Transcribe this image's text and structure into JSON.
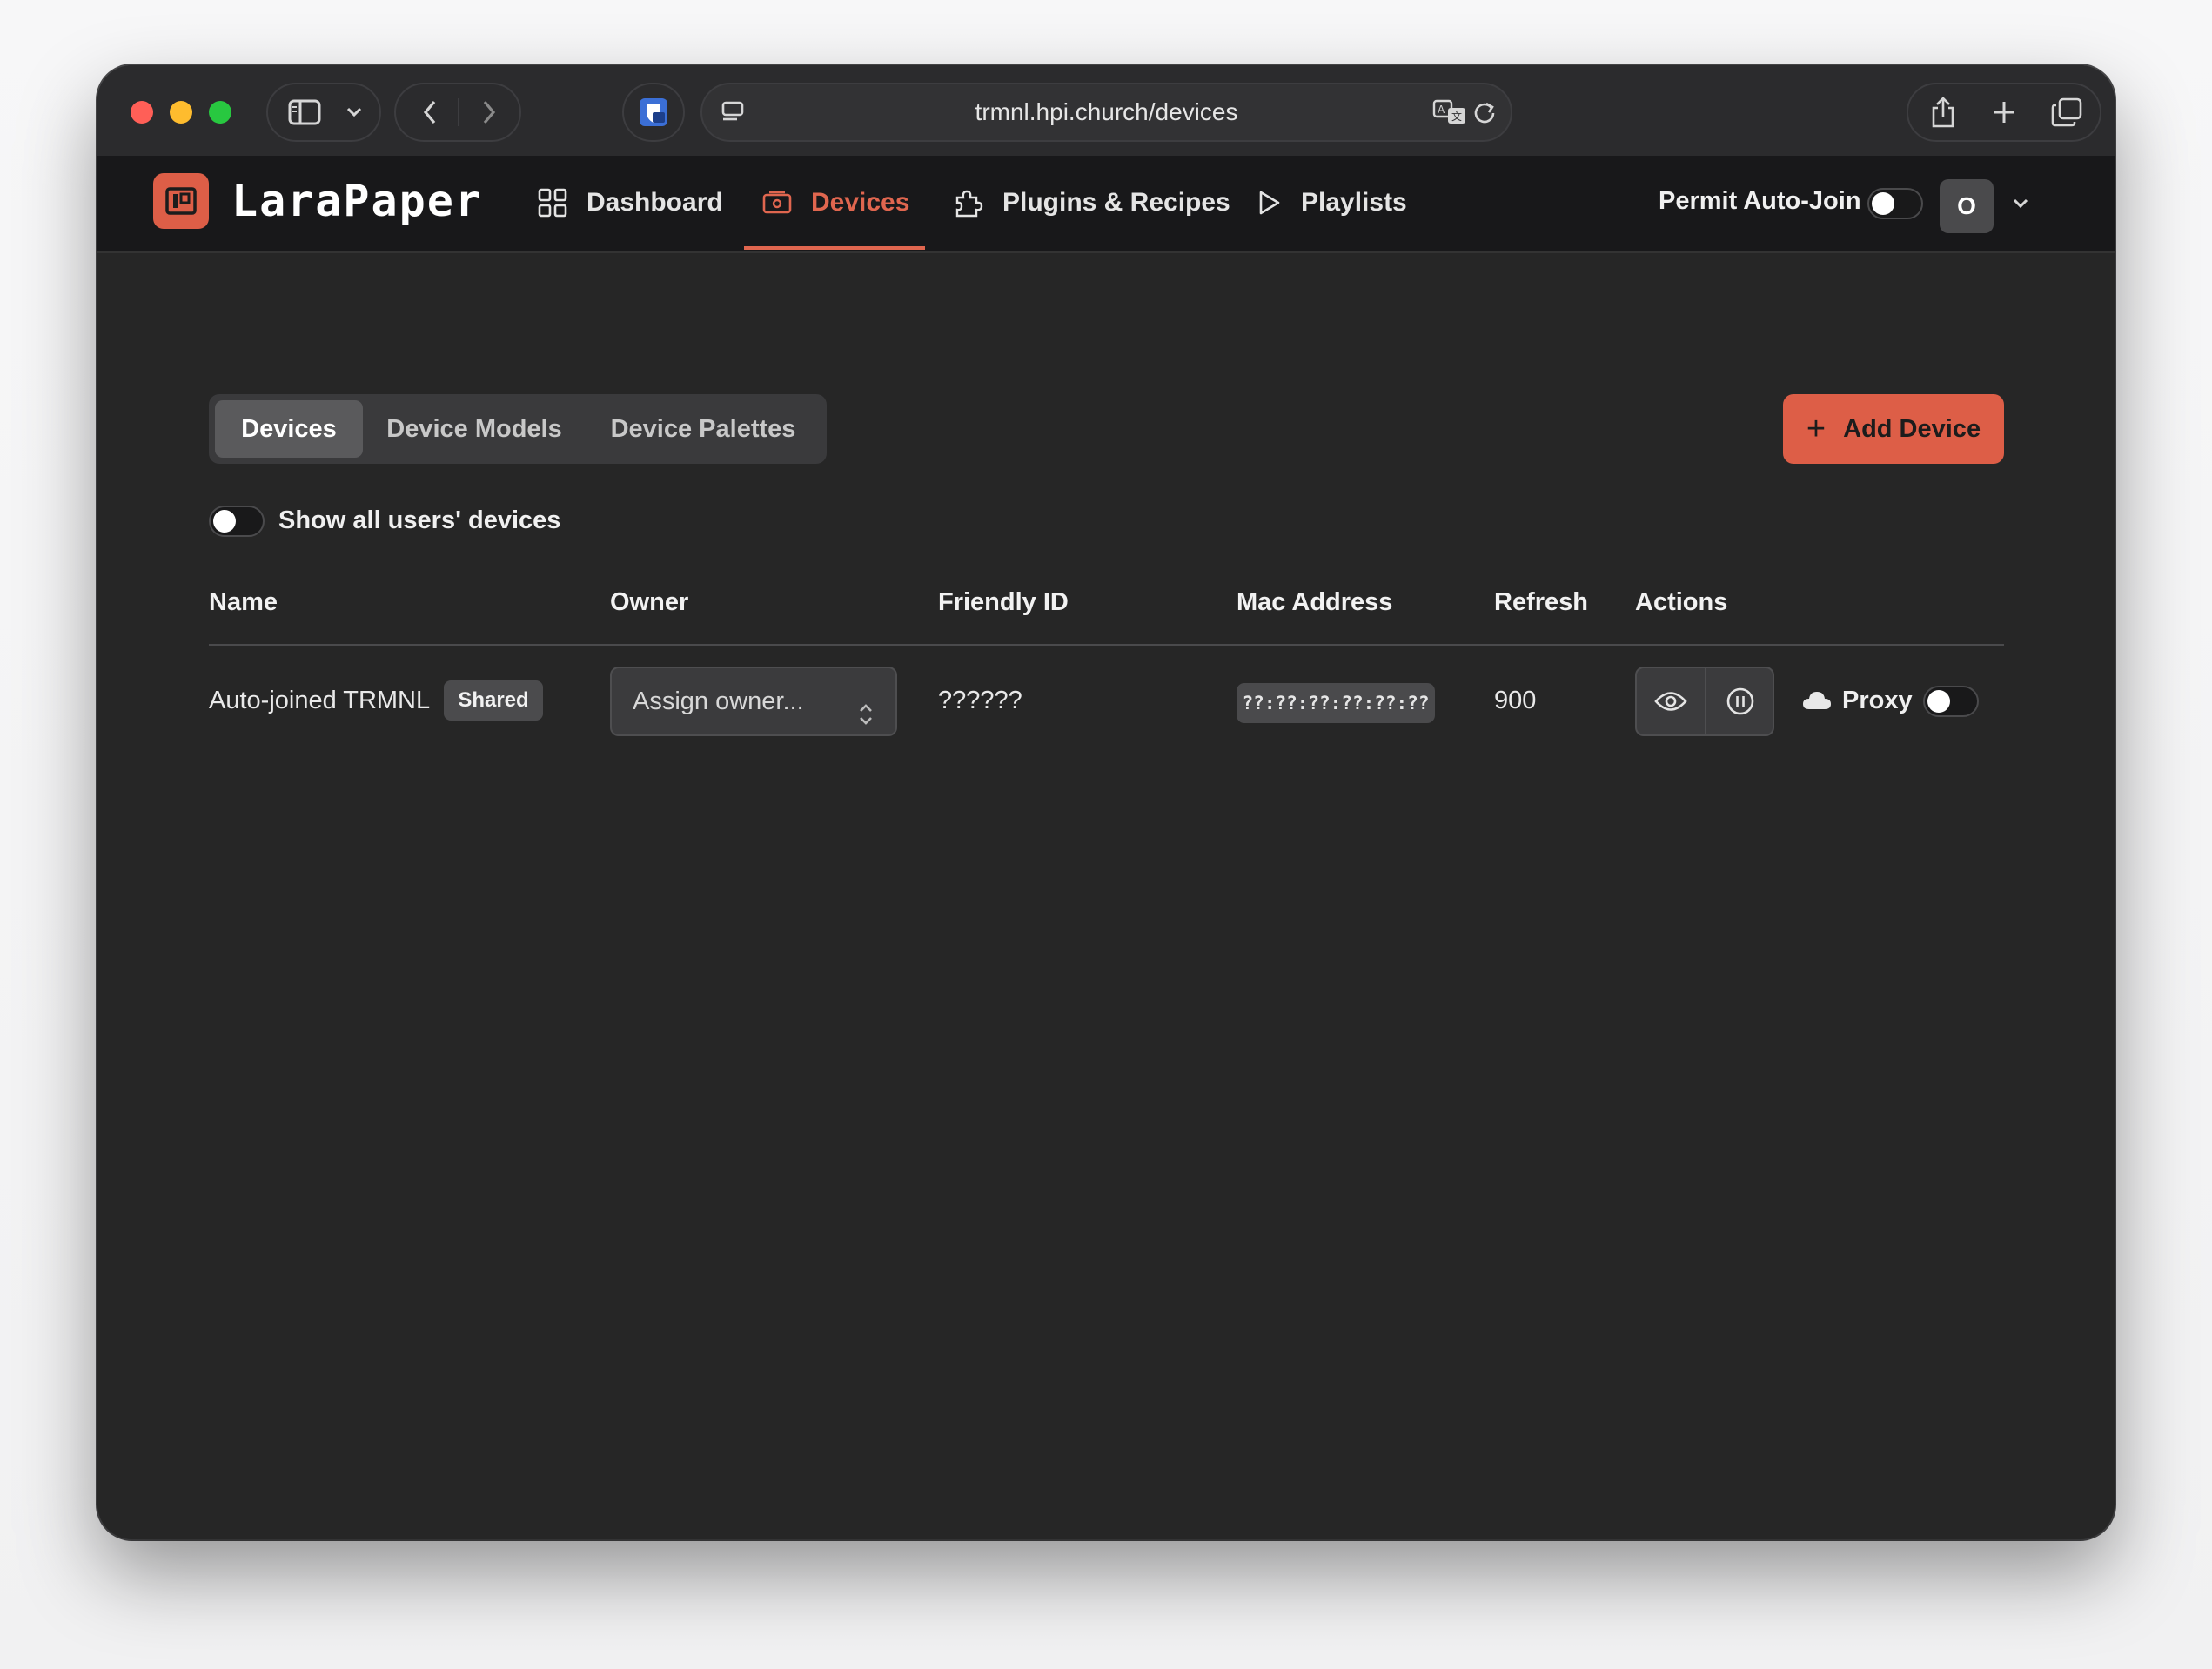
{
  "browser": {
    "url": "trmnl.hpi.church/devices"
  },
  "app": {
    "logo_text": "LaraPaper",
    "nav": [
      {
        "label": "Dashboard",
        "icon": "grid-icon"
      },
      {
        "label": "Devices",
        "icon": "device-icon",
        "active": true
      },
      {
        "label": "Plugins & Recipes",
        "icon": "puzzle-icon"
      },
      {
        "label": "Playlists",
        "icon": "play-icon"
      }
    ],
    "permit_auto_join_label": "Permit Auto-Join",
    "permit_auto_join_on": false,
    "avatar_initial": "O"
  },
  "tabs": [
    {
      "label": "Devices",
      "active": true
    },
    {
      "label": "Device Models",
      "active": false
    },
    {
      "label": "Device Palettes",
      "active": false
    }
  ],
  "add_device_label": "Add Device",
  "show_all_label": "Show all users' devices",
  "show_all_on": false,
  "table": {
    "headers": [
      "Name",
      "Owner",
      "Friendly ID",
      "Mac Address",
      "Refresh",
      "Actions"
    ],
    "rows": [
      {
        "name": "Auto-joined TRMNL",
        "badge": "Shared",
        "owner_placeholder": "Assign owner...",
        "friendly_id": "??????",
        "mac": "??:??:??:??:??:??",
        "refresh": "900",
        "proxy_label": "Proxy",
        "proxy_on": false
      }
    ]
  },
  "colors": {
    "accent": "#dd5e47",
    "background": "#262626",
    "nav_background": "#18181a"
  }
}
